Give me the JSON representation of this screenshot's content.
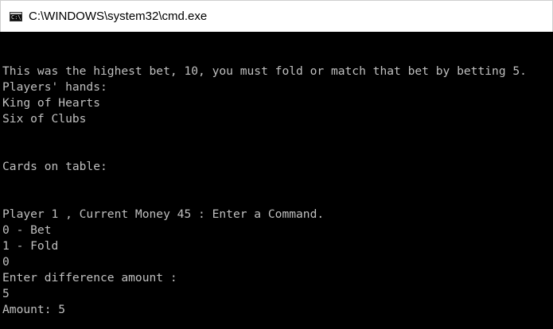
{
  "window": {
    "title": "C:\\WINDOWS\\system32\\cmd.exe",
    "icon": "cmd-icon",
    "icon_glyph": "C:\\"
  },
  "console": {
    "background": "#000000",
    "foreground": "#c0c0c0",
    "lines": [
      "This was the highest bet, 10, you must fold or match that bet by betting 5.",
      "Players' hands:",
      "King of Hearts",
      "Six of Clubs",
      "",
      "",
      "Cards on table:",
      "",
      "",
      "Player 1 , Current Money 45 : Enter a Command.",
      "0 - Bet",
      "1 - Fold",
      "0",
      "Enter difference amount :",
      "5",
      "Amount: 5"
    ]
  }
}
